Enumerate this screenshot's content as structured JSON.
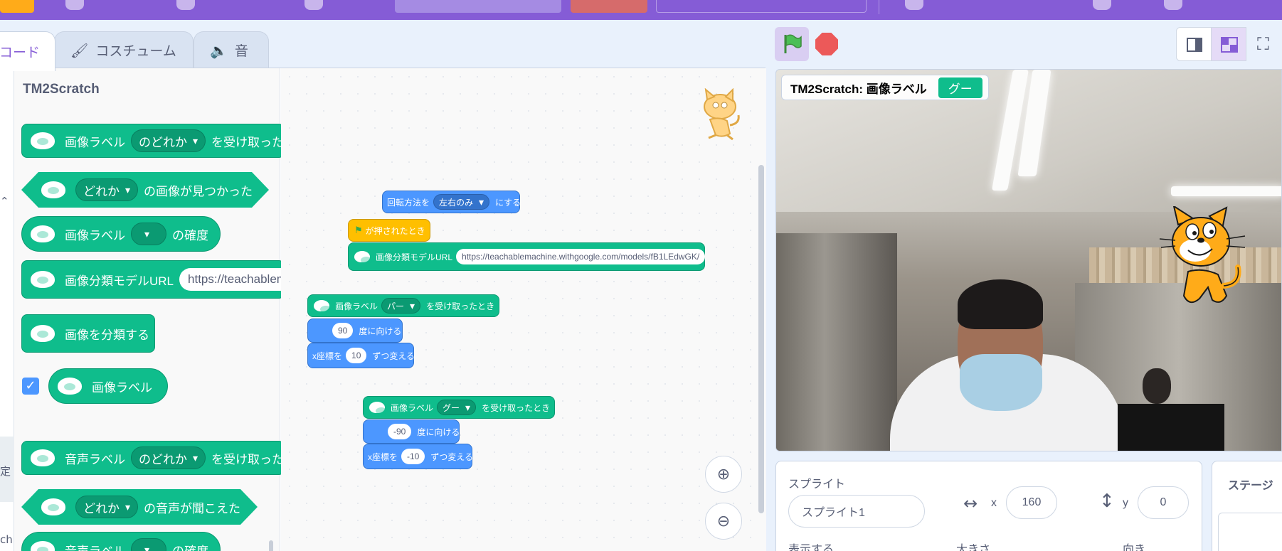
{
  "tabs": {
    "code": "コード",
    "costume": "コスチューム",
    "sound": "音"
  },
  "side": {
    "partial_1": "定",
    "partial_2": "ch"
  },
  "palette": {
    "title": "TM2Scratch",
    "b1": {
      "text1": "画像ラベル",
      "dd": "のどれか",
      "text2": "を受け取った"
    },
    "b2": {
      "dd": "どれか",
      "text": "の画像が見つかった"
    },
    "b3": {
      "text1": "画像ラベル",
      "text2": "の確度"
    },
    "b4": {
      "text": "画像分類モデルURL",
      "input": "https://teachablem"
    },
    "b5": {
      "text": "画像を分類する"
    },
    "b6": {
      "text": "画像ラベル",
      "checked": true
    },
    "b7": {
      "text1": "音声ラベル",
      "dd": "のどれか",
      "text2": "を受け取った"
    },
    "b8": {
      "dd": "どれか",
      "text": "の音声が聞こえた"
    },
    "b9": {
      "text1": "音声ラベル",
      "text2": "の確度"
    }
  },
  "script": {
    "rot": {
      "text1": "回転方法を",
      "dd": "左右のみ",
      "text2": "にする"
    },
    "flag_hat": {
      "text": "が押されたとき"
    },
    "url": {
      "text": "画像分類モデルURL",
      "input": "https://teachablemachine.withgoogle.com/models/fB1LEdwGK/"
    },
    "par_hat": {
      "text1": "画像ラベル",
      "dd": "パー",
      "text2": "を受け取ったとき"
    },
    "par_dir": {
      "val": "90",
      "text": "度に向ける"
    },
    "par_x": {
      "text1": "x座標を",
      "val": "10",
      "text2": "ずつ変える"
    },
    "goo_hat": {
      "text1": "画像ラベル",
      "dd": "グー",
      "text2": "を受け取ったとき"
    },
    "goo_dir": {
      "val": "-90",
      "text": "度に向ける"
    },
    "goo_x": {
      "text1": "x座標を",
      "val": "-10",
      "text2": "ずつ変える"
    }
  },
  "stage": {
    "monitor_label": "TM2Scratch: 画像ラベル",
    "monitor_value": "グー"
  },
  "sprite_info": {
    "heading": "スプライト",
    "name": "スプライト1",
    "x_label": "x",
    "x": "160",
    "y_label": "y",
    "y": "0",
    "show_label": "表示する",
    "size_label": "大きさ",
    "direction_label": "向き",
    "stage_heading": "ステージ"
  },
  "colors": {
    "menu": "#855cd6",
    "extension": "#0fbd8c",
    "motion": "#4c97ff",
    "events": "#ffbf00",
    "stop": "#ec5959"
  },
  "icons": [
    "brush-icon",
    "speaker-icon",
    "green-flag-icon",
    "stop-icon",
    "zoom-in-icon",
    "zoom-out-icon",
    "fullscreen-icon",
    "scratch-cat-icon",
    "checkmark-icon",
    "horizontal-arrows-icon",
    "vertical-arrows-icon"
  ]
}
